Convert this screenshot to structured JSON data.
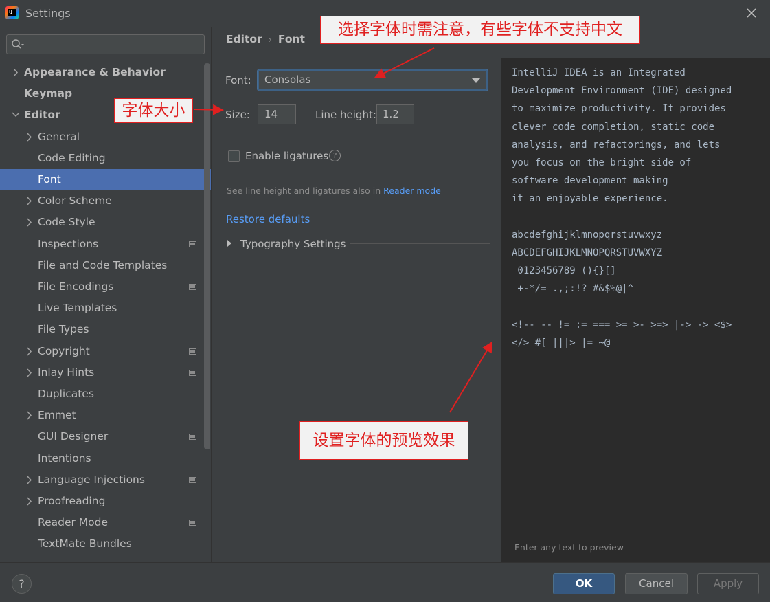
{
  "window": {
    "title": "Settings",
    "app_icon_text": "IJ"
  },
  "search": {
    "placeholder": ""
  },
  "sidebar": {
    "items": [
      {
        "label": "Appearance & Behavior",
        "expand": "collapsed",
        "bold": true,
        "level": 0
      },
      {
        "label": "Keymap",
        "expand": "none",
        "bold": true,
        "level": 0
      },
      {
        "label": "Editor",
        "expand": "expanded",
        "bold": true,
        "level": 0
      },
      {
        "label": "General",
        "expand": "collapsed",
        "level": 1
      },
      {
        "label": "Code Editing",
        "expand": "none",
        "level": 1
      },
      {
        "label": "Font",
        "expand": "none",
        "level": 1,
        "selected": true
      },
      {
        "label": "Color Scheme",
        "expand": "collapsed",
        "level": 1
      },
      {
        "label": "Code Style",
        "expand": "collapsed",
        "level": 1
      },
      {
        "label": "Inspections",
        "expand": "none",
        "level": 1,
        "project_icon": true
      },
      {
        "label": "File and Code Templates",
        "expand": "none",
        "level": 1
      },
      {
        "label": "File Encodings",
        "expand": "none",
        "level": 1,
        "project_icon": true
      },
      {
        "label": "Live Templates",
        "expand": "none",
        "level": 1
      },
      {
        "label": "File Types",
        "expand": "none",
        "level": 1
      },
      {
        "label": "Copyright",
        "expand": "collapsed",
        "level": 1,
        "project_icon": true
      },
      {
        "label": "Inlay Hints",
        "expand": "collapsed",
        "level": 1,
        "project_icon": true
      },
      {
        "label": "Duplicates",
        "expand": "none",
        "level": 1
      },
      {
        "label": "Emmet",
        "expand": "collapsed",
        "level": 1
      },
      {
        "label": "GUI Designer",
        "expand": "none",
        "level": 1,
        "project_icon": true
      },
      {
        "label": "Intentions",
        "expand": "none",
        "level": 1
      },
      {
        "label": "Language Injections",
        "expand": "collapsed",
        "level": 1,
        "project_icon": true
      },
      {
        "label": "Proofreading",
        "expand": "collapsed",
        "level": 1
      },
      {
        "label": "Reader Mode",
        "expand": "none",
        "level": 1,
        "project_icon": true
      },
      {
        "label": "TextMate Bundles",
        "expand": "none",
        "level": 1
      }
    ]
  },
  "breadcrumb": {
    "parent": "Editor",
    "separator": "›",
    "current": "Font"
  },
  "form": {
    "font_label": "Font:",
    "font_value": "Consolas",
    "size_label": "Size:",
    "size_value": "14",
    "line_height_label": "Line height:",
    "line_height_value": "1.2",
    "ligatures_label": "Enable ligatures",
    "ligatures_checked": false,
    "help_glyph": "?",
    "hint_text": "See line height and ligatures also in ",
    "hint_link": "Reader mode",
    "restore_label": "Restore defaults",
    "typography_label": "Typography Settings"
  },
  "preview": {
    "text": "IntelliJ IDEA is an Integrated\nDevelopment Environment (IDE) designed\nto maximize productivity. It provides\nclever code completion, static code\nanalysis, and refactorings, and lets\nyou focus on the bright side of\nsoftware development making\nit an enjoyable experience.\n\nabcdefghijklmnopqrstuvwxyz\nABCDEFGHIJKLMNOPQRSTUVWXYZ\n 0123456789 (){}[]\n +-*/= .,;:!? #&$%@|^\n\n<!-- -- != := === >= >- >=> |-> -> <$>\n</> #[ |||> |= ~@",
    "hint": "Enter any text to preview"
  },
  "footer": {
    "help_glyph": "?",
    "ok_label": "OK",
    "cancel_label": "Cancel",
    "apply_label": "Apply"
  },
  "annotations": {
    "top": "选择字体时需注意，有些字体不支持中文",
    "size": "字体大小",
    "preview": "设置字体的预览效果"
  },
  "colors": {
    "background": "#3c3f41",
    "selection": "#4b6eaf",
    "link": "#589df6",
    "preview_bg": "#2b2b2b",
    "annotation_red": "#e02020"
  }
}
